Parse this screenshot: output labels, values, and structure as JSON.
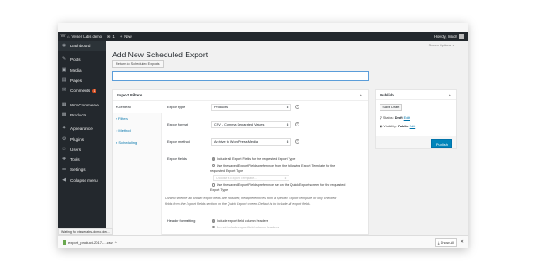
{
  "admin_bar": {
    "site_name": "Visser Labs demo",
    "comments_count": "1",
    "new_label": "New",
    "greeting": "Howdy, Insidr"
  },
  "sidebar": {
    "items": [
      {
        "label": "Dashboard",
        "icon": "dashboard-icon",
        "glyph": "◉"
      },
      {
        "label": "Posts",
        "icon": "pin-icon",
        "glyph": "✎"
      },
      {
        "label": "Media",
        "icon": "media-icon",
        "glyph": "▣"
      },
      {
        "label": "Pages",
        "icon": "pages-icon",
        "glyph": "▤"
      },
      {
        "label": "Comments",
        "icon": "comments-icon",
        "glyph": "✉",
        "badge": "1"
      },
      {
        "label": "WooCommerce",
        "icon": "woocommerce-icon",
        "glyph": "▦"
      },
      {
        "label": "Products",
        "icon": "products-icon",
        "glyph": "▩"
      },
      {
        "label": "Appearance",
        "icon": "appearance-icon",
        "glyph": "✦"
      },
      {
        "label": "Plugins",
        "icon": "plugins-icon",
        "glyph": "⚙"
      },
      {
        "label": "Users",
        "icon": "users-icon",
        "glyph": "☺"
      },
      {
        "label": "Tools",
        "icon": "tools-icon",
        "glyph": "✚"
      },
      {
        "label": "Settings",
        "icon": "settings-icon",
        "glyph": "☰"
      },
      {
        "label": "Collapse menu",
        "icon": "collapse-icon",
        "glyph": "◀"
      }
    ]
  },
  "header": {
    "screen_options": "Screen Options ▼",
    "title": "Add New Scheduled Export",
    "return_button": "Return to Scheduled Exports"
  },
  "export_filters": {
    "heading": "Export Filters",
    "toggle": "▲",
    "tabs": [
      {
        "label": "General",
        "glyph": "▪"
      },
      {
        "label": "Filters",
        "glyph": "▿"
      },
      {
        "label": "Method",
        "glyph": "◌"
      },
      {
        "label": "Scheduling",
        "glyph": "●"
      }
    ],
    "fields": {
      "export_type_label": "Export type",
      "export_type_value": "Products",
      "export_format_label": "Export format",
      "export_format_value": "CSV - Comma Separated Values",
      "export_method_label": "Export method",
      "export_method_value": "Archive to WordPress Media",
      "export_fields_label": "Export fields",
      "fields_option_1": "Include all Export Fields for the requested Export Type",
      "fields_option_2a": "Use the saved Export Fields preference from the following Export Template for the",
      "fields_option_2b": "requested Export Type",
      "template_placeholder": "Choose a Export Template...",
      "fields_option_3a": "Use the saved Export Fields preference set on the Quick Export screen for the requested",
      "fields_option_3b": "Export Type",
      "description_1": "Control whether all known export fields are included, field preferences from a specific Export Template or only checked",
      "description_2": "fields from the Export Fields section on the Quick Export screen. Default is to include all export fields.",
      "header_formatting_label": "Header formatting",
      "header_option_1": "Include export field column headers",
      "header_option_2": "Do not include export field column headers"
    }
  },
  "publish": {
    "heading": "Publish",
    "toggle": "▲",
    "save_draft": "Save Draft",
    "status_label": "Status:",
    "status_value": "Draft",
    "status_edit": "Edit",
    "visibility_label": "Visibility:",
    "visibility_value": "Public",
    "visibility_edit": "Edit",
    "publish_button": "Publish"
  },
  "browser": {
    "status_text": "Waiting for visserlabs-demo.dev...",
    "download_filename": "export_product-2017-....csv",
    "download_chevron": "^",
    "show_all": "Show All",
    "close": "✕"
  }
}
